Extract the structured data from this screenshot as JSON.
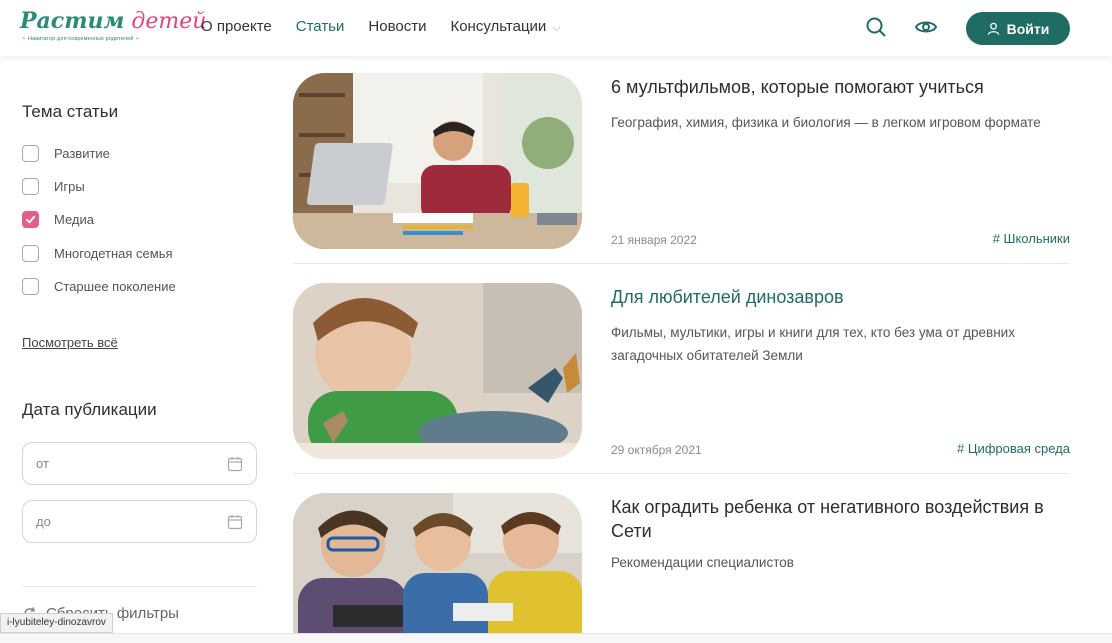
{
  "logo": {
    "main_a": "Растим",
    "main_b": " детей",
    "subtitle": "Навигатор для современных родителей"
  },
  "nav": {
    "items": [
      "О проекте",
      "Статьи",
      "Новости",
      "Консультации"
    ],
    "active": "Статьи"
  },
  "header": {
    "login_label": "Войти",
    "icons": [
      "search-icon",
      "eye-icon",
      "user-icon"
    ]
  },
  "filters": {
    "topic_title": "Тема статьи",
    "topics": [
      {
        "label": "Развитие",
        "checked": false
      },
      {
        "label": "Игры",
        "checked": false
      },
      {
        "label": "Медиа",
        "checked": true
      },
      {
        "label": "Многодетная семья",
        "checked": false
      },
      {
        "label": "Старшее поколение",
        "checked": false
      }
    ],
    "see_all": "Посмотреть всё",
    "date_title": "Дата публикации",
    "date_from_placeholder": "от",
    "date_to_placeholder": "до",
    "reset_label": "Сбросить фильтры"
  },
  "articles": [
    {
      "title": "6 мультфильмов, которые помогают учиться",
      "desc": "География, химия, физика и биология — в легком игровом формате",
      "date": "21 января 2022",
      "tag": "# Школьники"
    },
    {
      "title": "Для любителей динозавров",
      "desc": "Фильмы, мультики, игры и книги для тех, кто без ума от древних загадочных обитателей Земли",
      "date": "29 октября 2021",
      "tag": "# Цифровая среда"
    },
    {
      "title": "Как оградить ребенка от негативного воздействия в Сети",
      "desc": "Рекомендации специалистов",
      "date": "",
      "tag": ""
    }
  ],
  "status_bar": {
    "url": "i-lyubiteley-dinozavrov"
  },
  "colors": {
    "accent": "#1f6c64",
    "pink": "#e05f8c"
  }
}
